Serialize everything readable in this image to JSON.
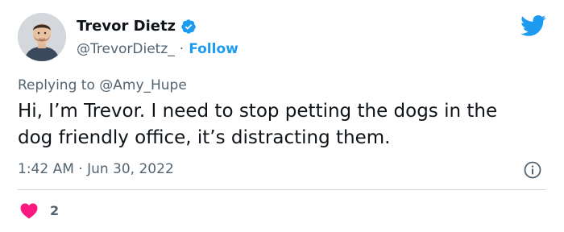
{
  "author": {
    "display_name": "Trevor Dietz",
    "handle": "@TrevorDietz_",
    "separator": "·",
    "follow_label": "Follow",
    "verified": true
  },
  "tweet": {
    "reply_prefix": "Replying to",
    "reply_mention": "@Amy_Hupe",
    "text": "Hi, I’m Trevor. I need to stop petting the dogs in the dog friendly office, it’s distracting them.",
    "timestamp": "1:42 AM · Jun 30, 2022",
    "like_count": "2"
  },
  "icons": {
    "brand": "twitter-bird-icon",
    "verified": "verified-badge-icon",
    "info": "info-icon",
    "like": "heart-icon"
  },
  "colors": {
    "accent": "#1d9bf0",
    "like": "#f91880",
    "text": "#0f1419",
    "secondary": "#536471"
  }
}
